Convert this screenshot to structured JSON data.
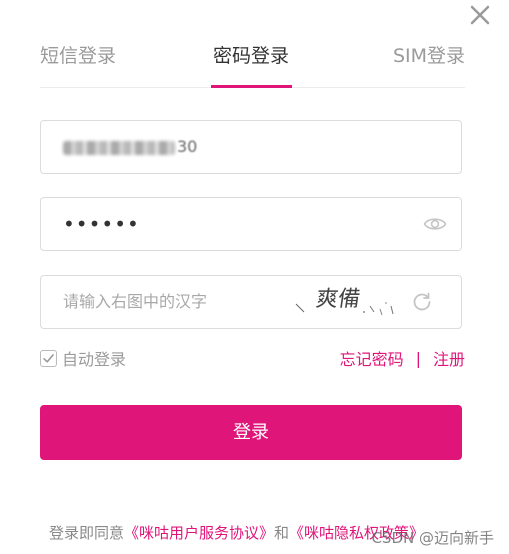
{
  "close": {
    "icon": "close-icon"
  },
  "tabs": [
    {
      "label": "短信登录",
      "active": false
    },
    {
      "label": "密码登录",
      "active": true
    },
    {
      "label": "SIM登录",
      "active": false
    }
  ],
  "phone_field": {
    "value_tail": "30"
  },
  "password_field": {
    "value": "••••••",
    "toggle_icon": "eye-icon"
  },
  "captcha_field": {
    "placeholder": "请输入右图中的汉字",
    "image_text": "爽備",
    "refresh_icon": "refresh-icon"
  },
  "auto_login": {
    "label": "自动登录",
    "checked": true
  },
  "links": {
    "forgot_password": "忘记密码",
    "separator": "|",
    "register": "注册"
  },
  "login_button": {
    "label": "登录"
  },
  "agreement": {
    "prefix": "登录即同意",
    "user_agreement": "《咪咕用户服务协议》",
    "conjunction": "和",
    "privacy_policy": "《咪咕隐私权政策》"
  },
  "watermark": "CSDN @迈向新手",
  "colors": {
    "accent": "#e0157a",
    "border": "#dcdcdc",
    "muted_text": "#9a9a9a"
  }
}
